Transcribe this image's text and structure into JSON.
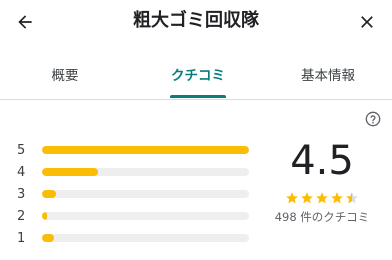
{
  "header": {
    "title": "粗大ゴミ回収隊",
    "back_icon": "arrow-left-icon",
    "close_icon": "close-icon"
  },
  "tabs": [
    {
      "label": "概要",
      "active": false
    },
    {
      "label": "クチコミ",
      "active": true
    },
    {
      "label": "基本情報",
      "active": false
    }
  ],
  "colors": {
    "accent": "#0b7d7d",
    "bar": "#fbbc04",
    "track": "#eeeeee"
  },
  "rating": {
    "score": "4.5",
    "stars": 4.5,
    "review_count": "498 件のクチコミ",
    "help_icon": "help-circle-icon"
  },
  "distribution": [
    {
      "label": "5",
      "fraction": 1.0
    },
    {
      "label": "4",
      "fraction": 0.27
    },
    {
      "label": "3",
      "fraction": 0.07
    },
    {
      "label": "2",
      "fraction": 0.025
    },
    {
      "label": "1",
      "fraction": 0.06
    }
  ]
}
